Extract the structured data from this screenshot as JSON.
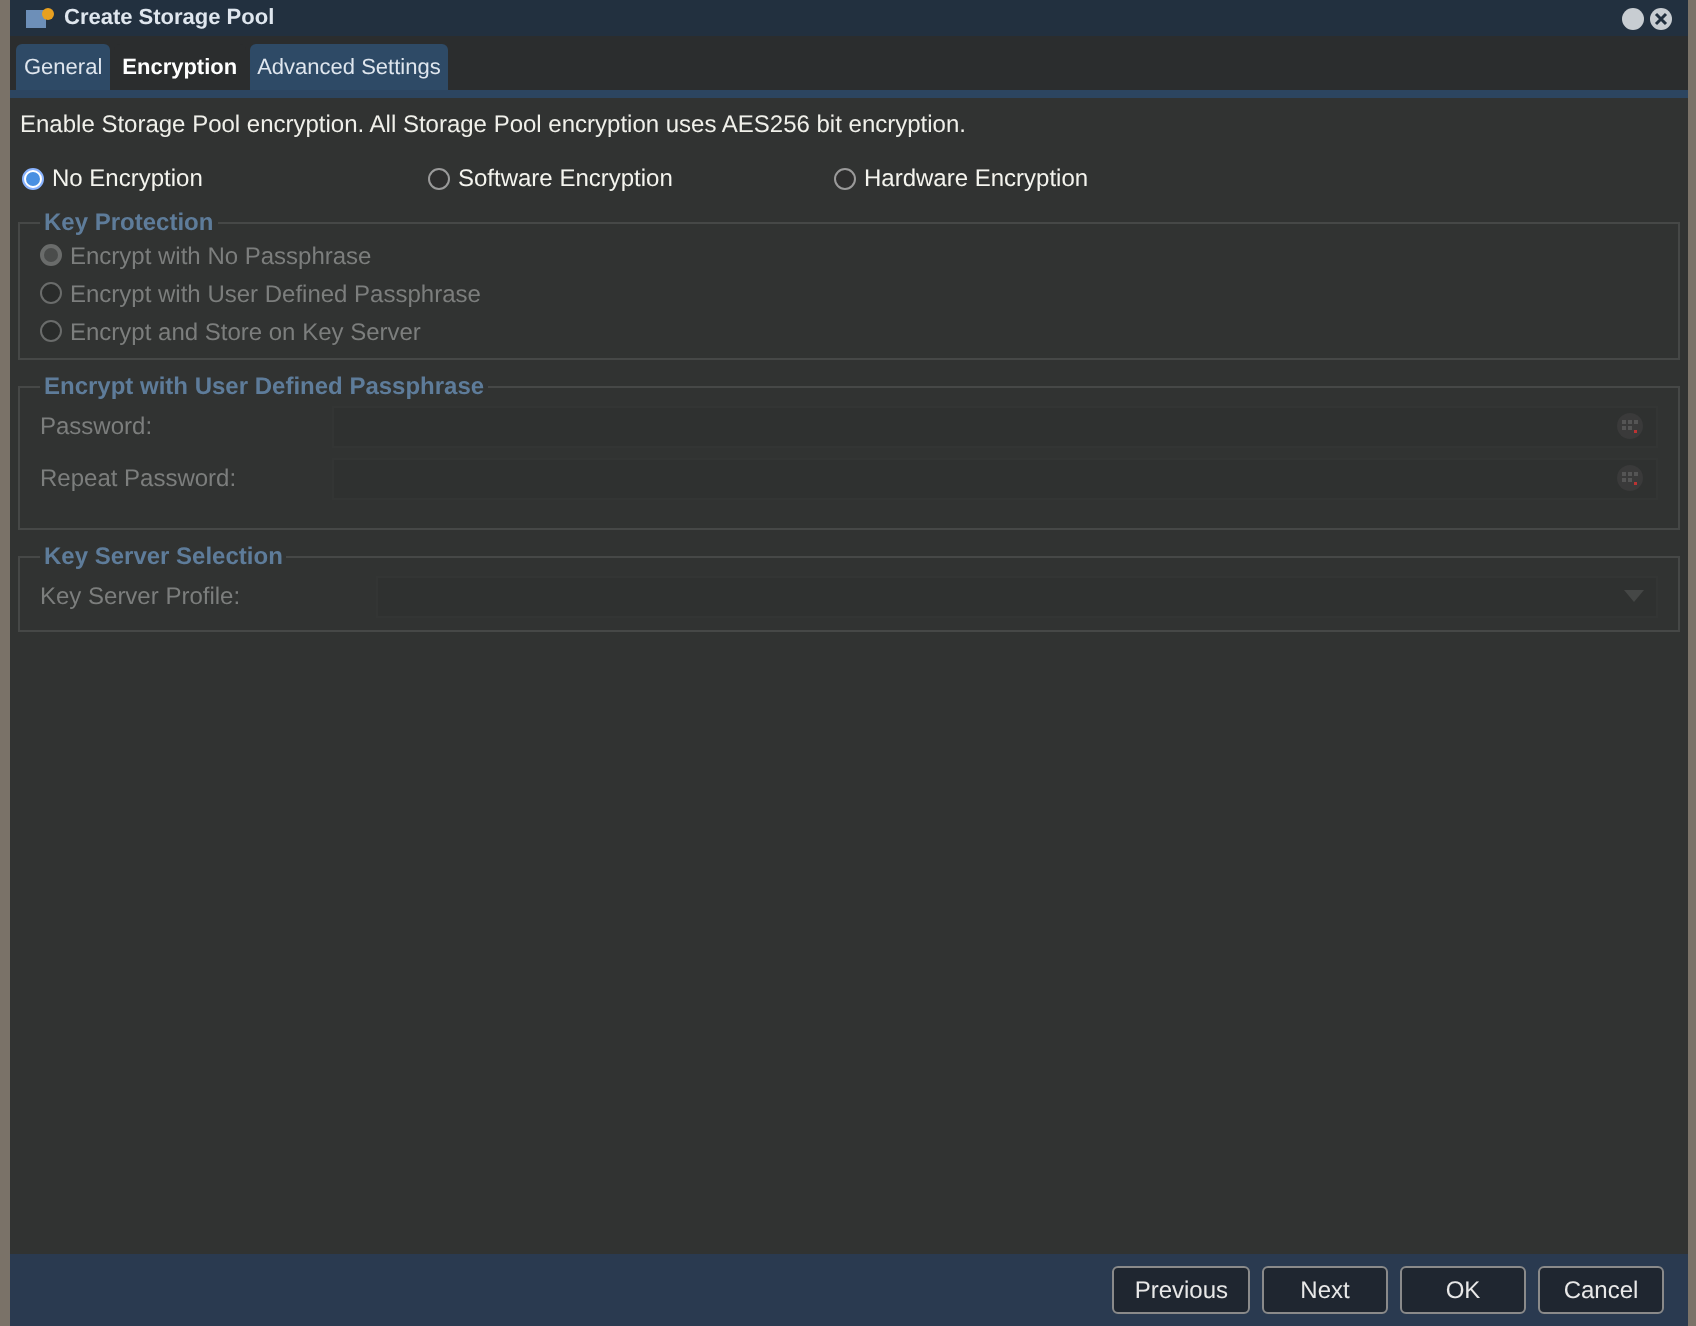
{
  "window": {
    "title": "Create Storage Pool"
  },
  "tabs": [
    {
      "label": "General",
      "selected": false
    },
    {
      "label": "Encryption",
      "selected": true
    },
    {
      "label": "Advanced Settings",
      "selected": false
    }
  ],
  "intro": "Enable Storage Pool encryption. All Storage Pool encryption uses AES256 bit encryption.",
  "encryption_options": [
    {
      "label": "No Encryption",
      "selected": true
    },
    {
      "label": "Software Encryption",
      "selected": false
    },
    {
      "label": "Hardware Encryption",
      "selected": false
    }
  ],
  "key_protection": {
    "title": "Key Protection",
    "disabled": true,
    "options": [
      {
        "label": "Encrypt with No Passphrase",
        "selected": true
      },
      {
        "label": "Encrypt with User Defined Passphrase",
        "selected": false
      },
      {
        "label": "Encrypt and Store on Key Server",
        "selected": false
      }
    ]
  },
  "passphrase": {
    "title": "Encrypt with User Defined Passphrase",
    "disabled": true,
    "fields": [
      {
        "label": "Password:"
      },
      {
        "label": "Repeat Password:"
      }
    ]
  },
  "key_server": {
    "title": "Key Server Selection",
    "disabled": true,
    "fields": [
      {
        "label": "Key Server Profile:"
      }
    ]
  },
  "buttons": [
    "Previous",
    "Next",
    "OK",
    "Cancel"
  ]
}
